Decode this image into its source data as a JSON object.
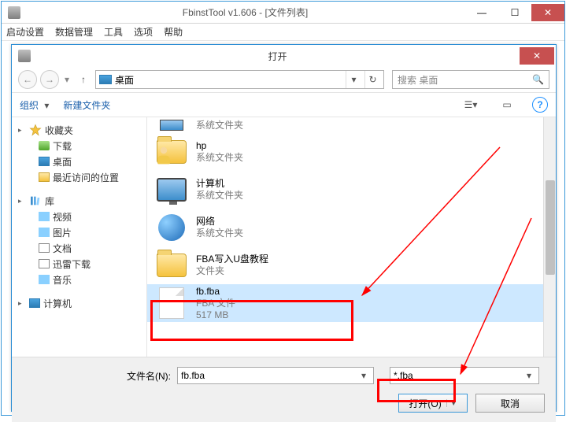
{
  "app": {
    "title": "FbinstTool v1.606 - [文件列表]",
    "menu": [
      "启动设置",
      "数据管理",
      "工具",
      "选项",
      "帮助"
    ],
    "win_btns": {
      "min": "—",
      "max": "☐",
      "close": "✕"
    }
  },
  "dialog": {
    "title": "打开",
    "close": "✕",
    "nav": {
      "back": "←",
      "fwd": "→",
      "dd": "▾",
      "up": "↑",
      "refresh": "↻"
    },
    "location": "桌面",
    "search_placeholder": "搜索 桌面",
    "toolbar": {
      "organize": "组织",
      "organize_dd": "▾",
      "newfolder": "新建文件夹",
      "view_dd": "▾"
    },
    "tree": {
      "favorites": {
        "label": "收藏夹",
        "items": [
          "下载",
          "桌面",
          "最近访问的位置"
        ]
      },
      "libraries": {
        "label": "库",
        "items": [
          "视频",
          "图片",
          "文档",
          "迅雷下载",
          "音乐"
        ]
      },
      "computer": "计算机"
    },
    "files": [
      {
        "name": "系统文件夹",
        "sub": "",
        "icon": "partial"
      },
      {
        "name": "hp",
        "sub": "系统文件夹",
        "icon": "person-folder"
      },
      {
        "name": "计算机",
        "sub": "系统文件夹",
        "icon": "monitor"
      },
      {
        "name": "网络",
        "sub": "系统文件夹",
        "icon": "globe"
      },
      {
        "name": "FBA写入U盘教程",
        "sub": "文件夹",
        "icon": "folder"
      },
      {
        "name": "fb.fba",
        "sub": "FBA 文件",
        "sub2": "517 MB",
        "icon": "file",
        "selected": true
      }
    ],
    "filename_label": "文件名(N):",
    "filename_value": "fb.fba",
    "filter_value": "*.fba",
    "open_btn": "打开(O)",
    "cancel_btn": "取消"
  }
}
